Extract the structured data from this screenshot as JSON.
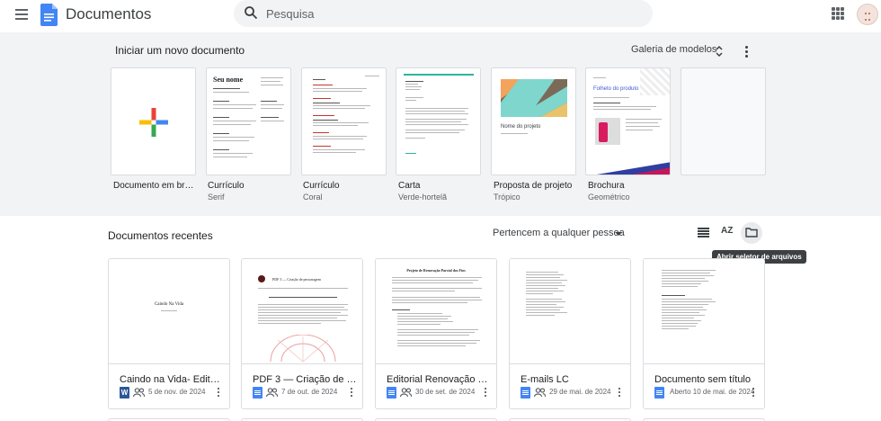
{
  "header": {
    "app_title": "Documentos",
    "search_placeholder": "Pesquisa",
    "menu_icon": "hamburger-menu-icon",
    "apps_icon": "google-apps-icon"
  },
  "templates": {
    "section_title": "Iniciar um novo documento",
    "gallery_button": "Galeria de modelos",
    "items": [
      {
        "label": "Documento em br…",
        "sub": ""
      },
      {
        "label": "Currículo",
        "sub": "Serif",
        "preview_heading": "Seu nome"
      },
      {
        "label": "Currículo",
        "sub": "Coral"
      },
      {
        "label": "Carta",
        "sub": "Verde-hortelã"
      },
      {
        "label": "Proposta de projeto",
        "sub": "Trópico",
        "preview_heading": "Nome do projeto"
      },
      {
        "label": "Brochura",
        "sub": "Geométrico",
        "preview_heading": "Folheto do produto"
      }
    ]
  },
  "recent": {
    "section_title": "Documentos recentes",
    "owner_filter": "Pertencem a qualquer pessoa",
    "sort_label": "AZ",
    "tooltip": "Abrir seletor de arquivos",
    "docs": [
      {
        "title": "Caindo na Vida- Editado.…",
        "type": "word",
        "shared": true,
        "date": "5 de nov. de 2024",
        "preview_heading": "Caindo Na Vida"
      },
      {
        "title": "PDF 3 — Criação de pers…",
        "type": "docs",
        "shared": true,
        "date": "7 de out. de 2024",
        "preview_heading": "PDF 3 — Criação de personagem"
      },
      {
        "title": "Editorial Renovação Parc…",
        "type": "docs",
        "shared": true,
        "date": "30 de set. de 2024",
        "preview_heading": "Projeto de Renovação Parcial dos Fios"
      },
      {
        "title": "E-mails LC",
        "type": "docs",
        "shared": true,
        "date": "29 de mai. de 2024"
      },
      {
        "title": "Documento sem título",
        "type": "docs",
        "shared": false,
        "date": "Aberto 10 de mai. de 2024"
      }
    ]
  },
  "colors": {
    "docs_blue": "#4285f4",
    "word_blue": "#2b579a",
    "gallery_bg": "#f1f3f4"
  }
}
